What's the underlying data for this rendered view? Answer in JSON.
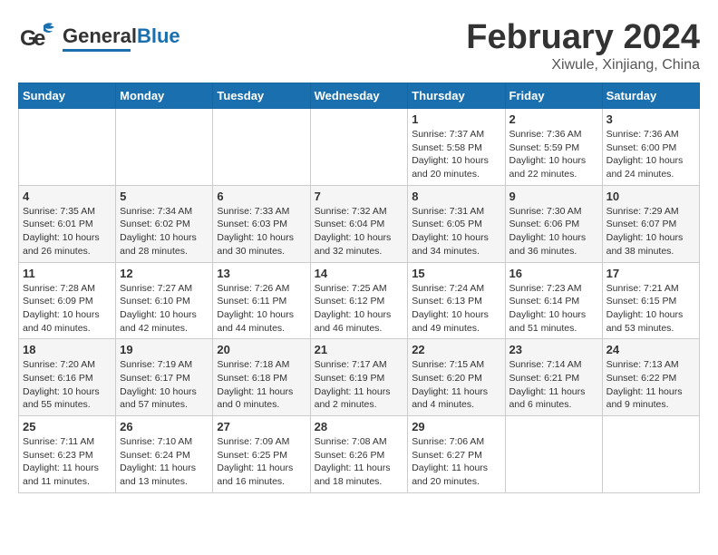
{
  "header": {
    "logo_general": "General",
    "logo_blue": "Blue",
    "month_title": "February 2024",
    "location": "Xiwule, Xinjiang, China"
  },
  "weekdays": [
    "Sunday",
    "Monday",
    "Tuesday",
    "Wednesday",
    "Thursday",
    "Friday",
    "Saturday"
  ],
  "weeks": [
    [
      {
        "day": "",
        "info": ""
      },
      {
        "day": "",
        "info": ""
      },
      {
        "day": "",
        "info": ""
      },
      {
        "day": "",
        "info": ""
      },
      {
        "day": "1",
        "info": "Sunrise: 7:37 AM\nSunset: 5:58 PM\nDaylight: 10 hours\nand 20 minutes."
      },
      {
        "day": "2",
        "info": "Sunrise: 7:36 AM\nSunset: 5:59 PM\nDaylight: 10 hours\nand 22 minutes."
      },
      {
        "day": "3",
        "info": "Sunrise: 7:36 AM\nSunset: 6:00 PM\nDaylight: 10 hours\nand 24 minutes."
      }
    ],
    [
      {
        "day": "4",
        "info": "Sunrise: 7:35 AM\nSunset: 6:01 PM\nDaylight: 10 hours\nand 26 minutes."
      },
      {
        "day": "5",
        "info": "Sunrise: 7:34 AM\nSunset: 6:02 PM\nDaylight: 10 hours\nand 28 minutes."
      },
      {
        "day": "6",
        "info": "Sunrise: 7:33 AM\nSunset: 6:03 PM\nDaylight: 10 hours\nand 30 minutes."
      },
      {
        "day": "7",
        "info": "Sunrise: 7:32 AM\nSunset: 6:04 PM\nDaylight: 10 hours\nand 32 minutes."
      },
      {
        "day": "8",
        "info": "Sunrise: 7:31 AM\nSunset: 6:05 PM\nDaylight: 10 hours\nand 34 minutes."
      },
      {
        "day": "9",
        "info": "Sunrise: 7:30 AM\nSunset: 6:06 PM\nDaylight: 10 hours\nand 36 minutes."
      },
      {
        "day": "10",
        "info": "Sunrise: 7:29 AM\nSunset: 6:07 PM\nDaylight: 10 hours\nand 38 minutes."
      }
    ],
    [
      {
        "day": "11",
        "info": "Sunrise: 7:28 AM\nSunset: 6:09 PM\nDaylight: 10 hours\nand 40 minutes."
      },
      {
        "day": "12",
        "info": "Sunrise: 7:27 AM\nSunset: 6:10 PM\nDaylight: 10 hours\nand 42 minutes."
      },
      {
        "day": "13",
        "info": "Sunrise: 7:26 AM\nSunset: 6:11 PM\nDaylight: 10 hours\nand 44 minutes."
      },
      {
        "day": "14",
        "info": "Sunrise: 7:25 AM\nSunset: 6:12 PM\nDaylight: 10 hours\nand 46 minutes."
      },
      {
        "day": "15",
        "info": "Sunrise: 7:24 AM\nSunset: 6:13 PM\nDaylight: 10 hours\nand 49 minutes."
      },
      {
        "day": "16",
        "info": "Sunrise: 7:23 AM\nSunset: 6:14 PM\nDaylight: 10 hours\nand 51 minutes."
      },
      {
        "day": "17",
        "info": "Sunrise: 7:21 AM\nSunset: 6:15 PM\nDaylight: 10 hours\nand 53 minutes."
      }
    ],
    [
      {
        "day": "18",
        "info": "Sunrise: 7:20 AM\nSunset: 6:16 PM\nDaylight: 10 hours\nand 55 minutes."
      },
      {
        "day": "19",
        "info": "Sunrise: 7:19 AM\nSunset: 6:17 PM\nDaylight: 10 hours\nand 57 minutes."
      },
      {
        "day": "20",
        "info": "Sunrise: 7:18 AM\nSunset: 6:18 PM\nDaylight: 11 hours\nand 0 minutes."
      },
      {
        "day": "21",
        "info": "Sunrise: 7:17 AM\nSunset: 6:19 PM\nDaylight: 11 hours\nand 2 minutes."
      },
      {
        "day": "22",
        "info": "Sunrise: 7:15 AM\nSunset: 6:20 PM\nDaylight: 11 hours\nand 4 minutes."
      },
      {
        "day": "23",
        "info": "Sunrise: 7:14 AM\nSunset: 6:21 PM\nDaylight: 11 hours\nand 6 minutes."
      },
      {
        "day": "24",
        "info": "Sunrise: 7:13 AM\nSunset: 6:22 PM\nDaylight: 11 hours\nand 9 minutes."
      }
    ],
    [
      {
        "day": "25",
        "info": "Sunrise: 7:11 AM\nSunset: 6:23 PM\nDaylight: 11 hours\nand 11 minutes."
      },
      {
        "day": "26",
        "info": "Sunrise: 7:10 AM\nSunset: 6:24 PM\nDaylight: 11 hours\nand 13 minutes."
      },
      {
        "day": "27",
        "info": "Sunrise: 7:09 AM\nSunset: 6:25 PM\nDaylight: 11 hours\nand 16 minutes."
      },
      {
        "day": "28",
        "info": "Sunrise: 7:08 AM\nSunset: 6:26 PM\nDaylight: 11 hours\nand 18 minutes."
      },
      {
        "day": "29",
        "info": "Sunrise: 7:06 AM\nSunset: 6:27 PM\nDaylight: 11 hours\nand 20 minutes."
      },
      {
        "day": "",
        "info": ""
      },
      {
        "day": "",
        "info": ""
      }
    ]
  ]
}
